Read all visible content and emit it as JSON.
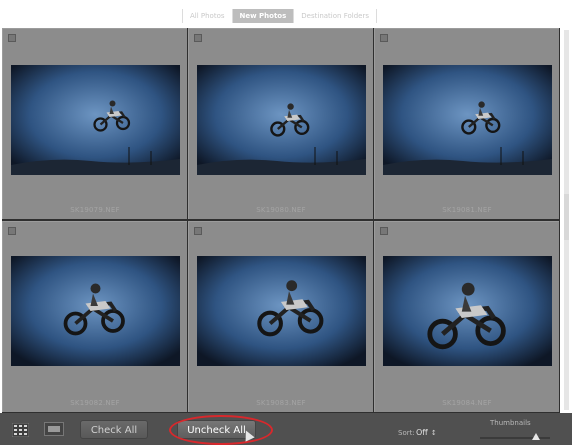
{
  "tabs": [
    {
      "label": "All Photos",
      "active": false
    },
    {
      "label": "New Photos",
      "active": true
    },
    {
      "label": "Destination Folders",
      "active": false
    }
  ],
  "photos": [
    {
      "filename": "SK19079.NEF",
      "checked": false
    },
    {
      "filename": "SK19080.NEF",
      "checked": false
    },
    {
      "filename": "SK19081.NEF",
      "checked": false
    },
    {
      "filename": "SK19082.NEF",
      "checked": false
    },
    {
      "filename": "SK19083.NEF",
      "checked": false
    },
    {
      "filename": "SK19084.NEF",
      "checked": false
    }
  ],
  "toolbar": {
    "grid_view_icon": "grid-view-icon",
    "loupe_view_icon": "loupe-view-icon",
    "check_all_label": "Check All",
    "uncheck_all_label": "Uncheck All",
    "sort_label": "Sort:",
    "sort_value": "Off",
    "sort_arrow": "↕",
    "thumbnails_label": "Thumbnails",
    "thumbnail_size_fraction": 0.8
  },
  "colors": {
    "highlight_ring": "#d8282c",
    "grid_background": "#8c8c8c",
    "toolbar_background": "#505050"
  }
}
